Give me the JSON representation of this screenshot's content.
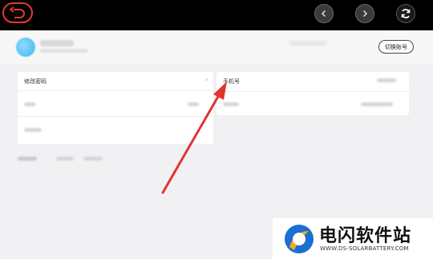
{
  "profile": {
    "switch_account_label": "切换账号"
  },
  "settings": {
    "change_password_label": "修改密码",
    "chevron": "›",
    "phone_label": "手机号"
  },
  "watermark": {
    "title": "电闪软件站",
    "url": "WWW.DS-SOLARBATTERY.COM"
  },
  "colors": {
    "arrow": "#e1352e",
    "back_button_border": "#e23b2e",
    "avatar": "#3bb3ef"
  }
}
